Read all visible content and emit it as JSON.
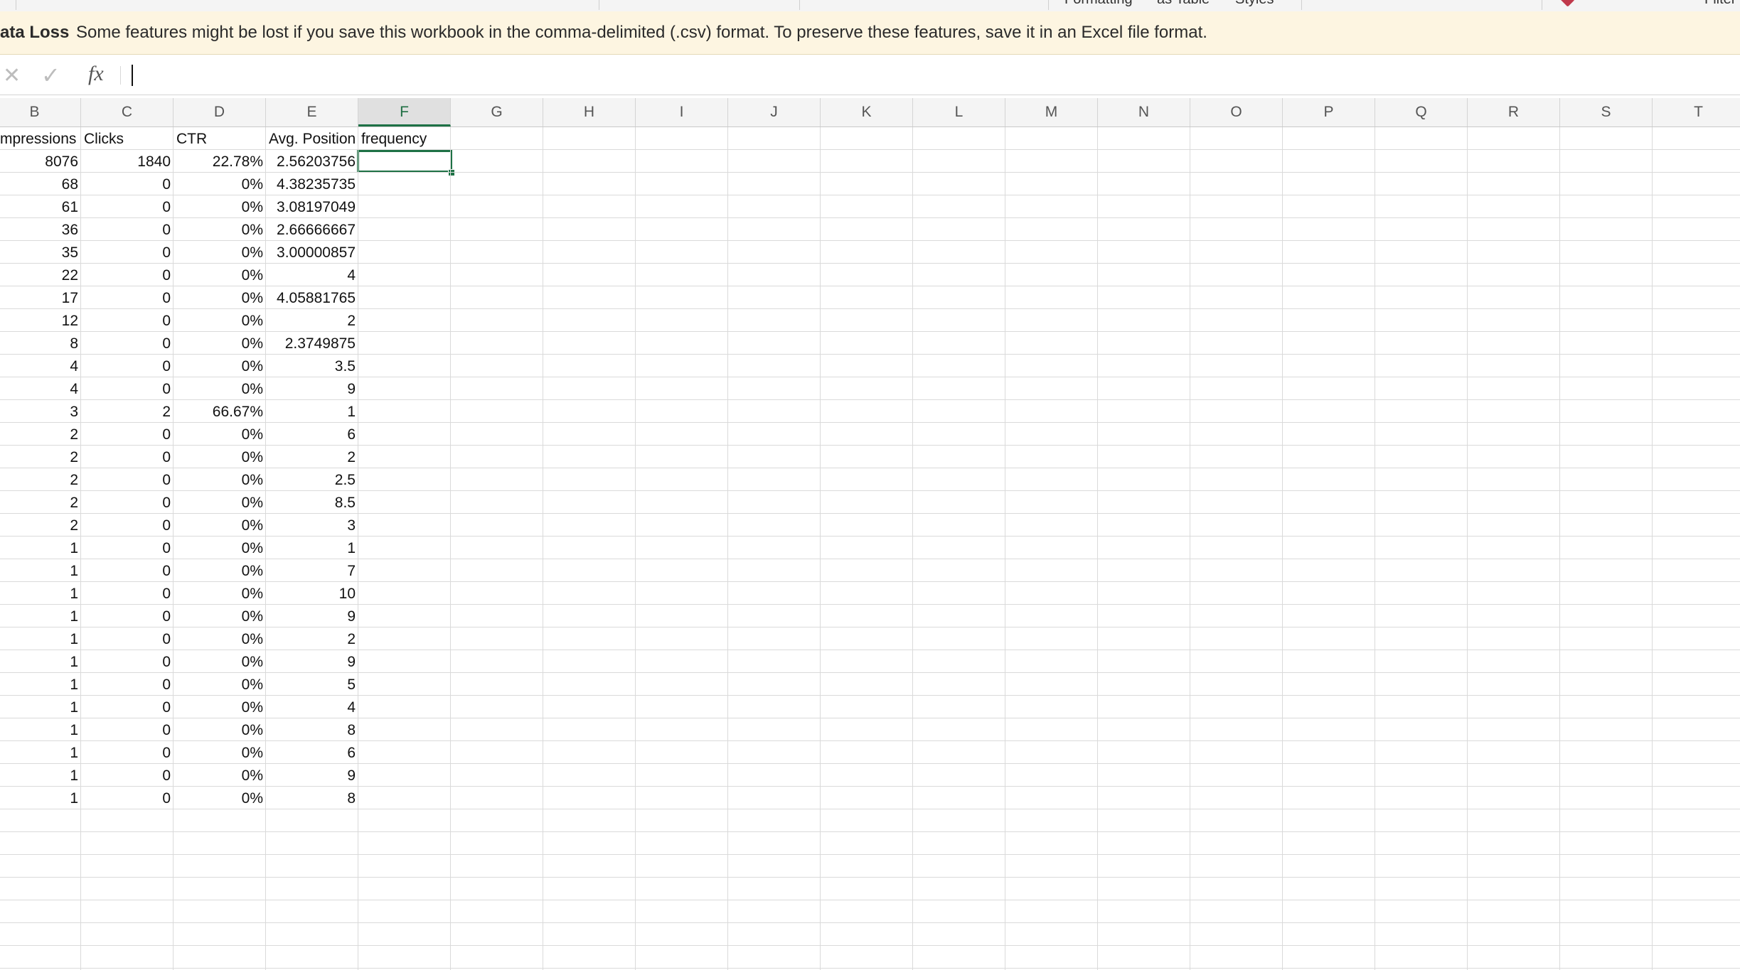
{
  "ribbon": {
    "items": [
      "Formatting",
      "as Table",
      "Styles",
      "Filter"
    ]
  },
  "message_bar": {
    "title": "ata Loss",
    "text": "Some features might be lost if you save this workbook in the comma-delimited (.csv) format. To preserve these features, save it in an Excel file format."
  },
  "formula_bar": {
    "cancel_icon": "close-icon",
    "enter_icon": "check-icon",
    "fx_label": "fx",
    "value": ""
  },
  "columns": [
    "B",
    "C",
    "D",
    "E",
    "F",
    "G",
    "H",
    "I",
    "J",
    "K",
    "L",
    "M",
    "N",
    "O",
    "P",
    "Q",
    "R",
    "S",
    "T"
  ],
  "selected_column": "F",
  "active_cell": "F2",
  "sheet": {
    "headers": [
      "mpressions",
      "Clicks",
      "CTR",
      "Avg. Position",
      "frequency"
    ],
    "rows": [
      [
        "8076",
        "1840",
        "22.78%",
        "2.56203756"
      ],
      [
        "68",
        "0",
        "0%",
        "4.38235735"
      ],
      [
        "61",
        "0",
        "0%",
        "3.08197049"
      ],
      [
        "36",
        "0",
        "0%",
        "2.66666667"
      ],
      [
        "35",
        "0",
        "0%",
        "3.00000857"
      ],
      [
        "22",
        "0",
        "0%",
        "4"
      ],
      [
        "17",
        "0",
        "0%",
        "4.05881765"
      ],
      [
        "12",
        "0",
        "0%",
        "2"
      ],
      [
        "8",
        "0",
        "0%",
        "2.3749875"
      ],
      [
        "4",
        "0",
        "0%",
        "3.5"
      ],
      [
        "4",
        "0",
        "0%",
        "9"
      ],
      [
        "3",
        "2",
        "66.67%",
        "1"
      ],
      [
        "2",
        "0",
        "0%",
        "6"
      ],
      [
        "2",
        "0",
        "0%",
        "2"
      ],
      [
        "2",
        "0",
        "0%",
        "2.5"
      ],
      [
        "2",
        "0",
        "0%",
        "8.5"
      ],
      [
        "2",
        "0",
        "0%",
        "3"
      ],
      [
        "1",
        "0",
        "0%",
        "1"
      ],
      [
        "1",
        "0",
        "0%",
        "7"
      ],
      [
        "1",
        "0",
        "0%",
        "10"
      ],
      [
        "1",
        "0",
        "0%",
        "9"
      ],
      [
        "1",
        "0",
        "0%",
        "2"
      ],
      [
        "1",
        "0",
        "0%",
        "9"
      ],
      [
        "1",
        "0",
        "0%",
        "5"
      ],
      [
        "1",
        "0",
        "0%",
        "4"
      ],
      [
        "1",
        "0",
        "0%",
        "8"
      ],
      [
        "1",
        "0",
        "0%",
        "6"
      ],
      [
        "1",
        "0",
        "0%",
        "9"
      ],
      [
        "1",
        "0",
        "0%",
        "8"
      ]
    ]
  },
  "colors": {
    "accent": "#1e7145",
    "message_bg": "#fdf5e1",
    "header_bg": "#f4f4f4",
    "gridline": "#dadada"
  }
}
